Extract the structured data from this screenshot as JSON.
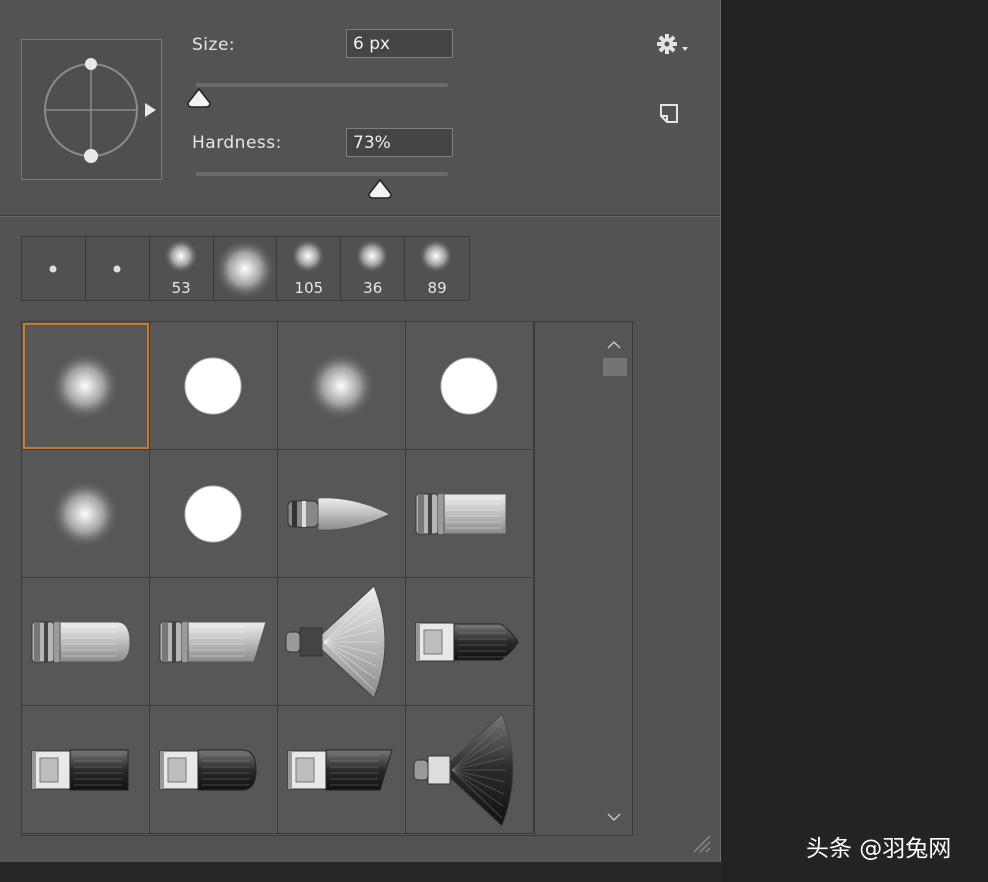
{
  "size": {
    "label": "Size:",
    "value": "6 px",
    "slider_fraction": 0.01
  },
  "hardness": {
    "label": "Hardness:",
    "value": "73%",
    "slider_fraction": 0.73
  },
  "icons": {
    "settings": "gear-icon",
    "new_preset": "new-preset-icon",
    "expand": "triangle-right-icon"
  },
  "recent_brushes": [
    {
      "kind": "dot-small",
      "number": ""
    },
    {
      "kind": "dot-small",
      "number": ""
    },
    {
      "kind": "soft",
      "number": "53"
    },
    {
      "kind": "soft-large",
      "number": ""
    },
    {
      "kind": "soft",
      "number": "105"
    },
    {
      "kind": "soft",
      "number": "36"
    },
    {
      "kind": "soft",
      "number": "89"
    }
  ],
  "presets": [
    {
      "kind": "soft-round",
      "selected": true
    },
    {
      "kind": "hard-round",
      "selected": false
    },
    {
      "kind": "soft-round",
      "selected": false
    },
    {
      "kind": "hard-round",
      "selected": false
    },
    {
      "kind": "soft-round",
      "selected": false
    },
    {
      "kind": "hard-round",
      "selected": false
    },
    {
      "kind": "brush-pointed",
      "selected": false
    },
    {
      "kind": "brush-flat-light",
      "selected": false
    },
    {
      "kind": "brush-round-light",
      "selected": false
    },
    {
      "kind": "brush-angle-light",
      "selected": false
    },
    {
      "kind": "brush-fan-light",
      "selected": false
    },
    {
      "kind": "brush-dark-pointed",
      "selected": false
    },
    {
      "kind": "brush-dark-flat",
      "selected": false
    },
    {
      "kind": "brush-dark-round",
      "selected": false
    },
    {
      "kind": "brush-dark-angle",
      "selected": false
    },
    {
      "kind": "brush-dark-fan",
      "selected": false
    }
  ],
  "scroll": {
    "up": "^",
    "down": "v"
  },
  "watermark": "头条 @羽兔网"
}
